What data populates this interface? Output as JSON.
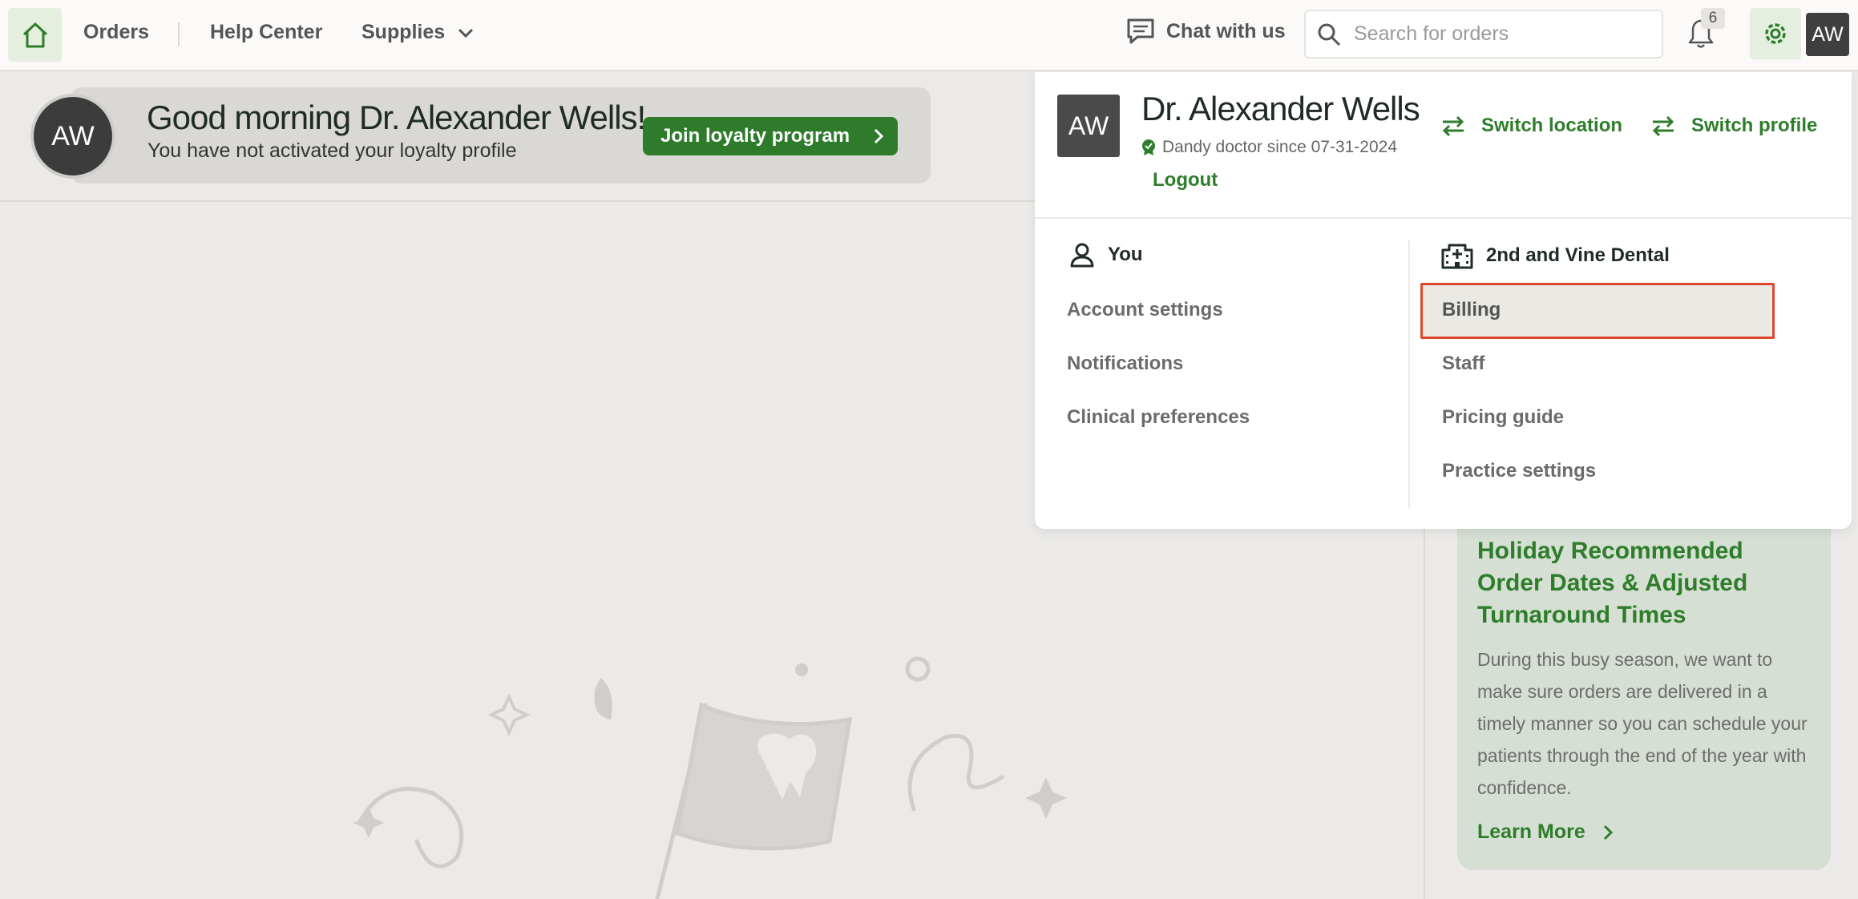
{
  "nav": {
    "orders": "Orders",
    "help_center": "Help Center",
    "supplies": "Supplies",
    "chat": "Chat with us",
    "search_placeholder": "Search for orders",
    "notification_count": "6",
    "avatar_initials": "AW"
  },
  "banner": {
    "avatar_initials": "AW",
    "title": "Good morning Dr. Alexander Wells!",
    "subtitle": "You have not activated your loyalty profile",
    "cta": "Join loyalty program"
  },
  "panel": {
    "avatar_initials": "AW",
    "name": "Dr. Alexander Wells",
    "since": "Dandy doctor since 07-31-2024",
    "logout": "Logout",
    "switch_location": "Switch location",
    "switch_profile": "Switch profile",
    "you": {
      "heading": "You",
      "items": [
        "Account settings",
        "Notifications",
        "Clinical preferences"
      ]
    },
    "practice": {
      "heading": "2nd and Vine Dental",
      "items": [
        "Billing",
        "Staff",
        "Pricing guide",
        "Practice settings"
      ]
    }
  },
  "card": {
    "title": "Holiday Recommended Order Dates & Adjusted Turnaround Times",
    "body": "During this busy season, we want to make sure orders are delivered in a timely manner so you can schedule your patients through the end of the year with confidence.",
    "link": "Learn More"
  },
  "colors": {
    "accent_green": "#2e7d2b",
    "button_green": "#2f7b2c",
    "highlight_red": "#e0472f"
  }
}
